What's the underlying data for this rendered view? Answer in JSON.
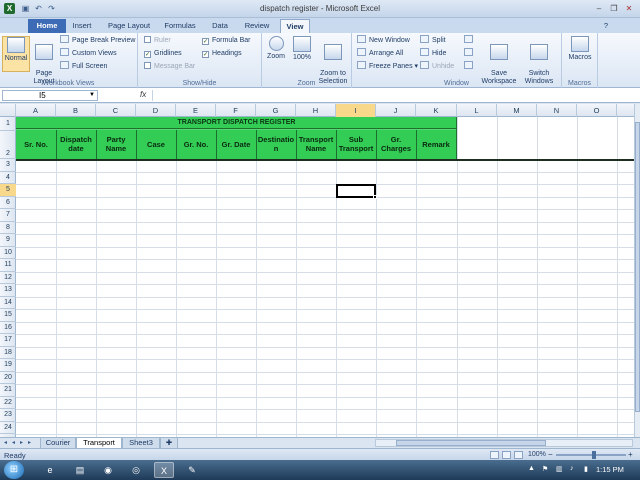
{
  "window": {
    "title": "dispatch register - Microsoft Excel"
  },
  "quick_access": {
    "save_icon": "save-icon",
    "undo_icon": "undo-icon",
    "redo_icon": "redo-icon"
  },
  "window_controls": {
    "minimize": "–",
    "restore": "❐",
    "close": "✕"
  },
  "ribbon_tabs": [
    "Home",
    "Insert",
    "Page Layout",
    "Formulas",
    "Data",
    "Review",
    "View"
  ],
  "active_tab": "View",
  "ribbon": {
    "workbook_views": {
      "label": "Workbook Views",
      "normal": "Normal",
      "page_layout": "Page\nLayout",
      "page_break_preview": "Page Break Preview",
      "custom_views": "Custom Views",
      "full_screen": "Full Screen"
    },
    "show_hide": {
      "label": "Show/Hide",
      "ruler": "Ruler",
      "gridlines": "Gridlines",
      "message_bar": "Message Bar",
      "formula_bar": "Formula Bar",
      "headings": "Headings"
    },
    "zoom": {
      "label": "Zoom",
      "zoom": "Zoom",
      "hundred": "100%",
      "zoom_to_selection": "Zoom to\nSelection"
    },
    "window": {
      "label": "Window",
      "new_window": "New Window",
      "arrange_all": "Arrange All",
      "freeze_panes": "Freeze Panes",
      "split": "Split",
      "hide": "Hide",
      "unhide": "Unhide",
      "save_workspace": "Save\nWorkspace",
      "switch_windows": "Switch\nWindows"
    },
    "macros": {
      "label": "Macros",
      "macros": "Macros"
    }
  },
  "formula_bar": {
    "name_box": "I5",
    "fx": "fx",
    "value": ""
  },
  "columns": [
    "A",
    "B",
    "C",
    "D",
    "E",
    "F",
    "G",
    "H",
    "I",
    "J",
    "K",
    "L",
    "M",
    "N",
    "O"
  ],
  "selected_column": "I",
  "rows": [
    "1",
    "2",
    "3",
    "4",
    "5",
    "6",
    "7",
    "8",
    "9",
    "10",
    "11",
    "12",
    "13",
    "14",
    "15",
    "16",
    "17",
    "18",
    "19",
    "20",
    "21",
    "22",
    "23",
    "24"
  ],
  "selected_row": "5",
  "table": {
    "title": "TRANSPORT DISPATCH REGISTER",
    "headers": [
      "Sr. No.",
      "Dispatch date",
      "Party Name",
      "Case",
      "Gr. No.",
      "Gr. Date",
      "Destination",
      "Transport Name",
      "Sub Transport",
      "Gr. Charges",
      "Remark"
    ],
    "fill_color": "#33cc55"
  },
  "sheet_tabs": [
    "Courier",
    "Transport",
    "Sheet3"
  ],
  "active_sheet": "Transport",
  "status": {
    "ready": "Ready",
    "zoom": "100%"
  },
  "taskbar": {
    "time": "1:15 PM"
  }
}
